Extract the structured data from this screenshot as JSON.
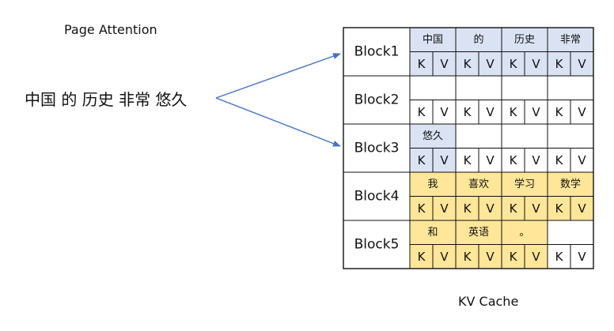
{
  "title": "Page Attention",
  "sentence": "中国 的 历史 非常 悠久",
  "cache_label": "KV Cache",
  "colors": {
    "blue_fill": "#dae3f3",
    "yellow_fill": "#ffe699",
    "white_fill": "#ffffff",
    "border": "#111111",
    "arrow": "#4472c4"
  },
  "blocks": [
    {
      "name": "Block1",
      "slots": [
        {
          "token": "中国",
          "filled": true,
          "fill": "blue"
        },
        {
          "token": "的",
          "filled": true,
          "fill": "blue"
        },
        {
          "token": "历史",
          "filled": true,
          "fill": "blue"
        },
        {
          "token": "非常",
          "filled": true,
          "fill": "blue"
        }
      ]
    },
    {
      "name": "Block2",
      "slots": [
        {
          "token": "",
          "filled": false,
          "fill": "white"
        },
        {
          "token": "",
          "filled": false,
          "fill": "white"
        },
        {
          "token": "",
          "filled": false,
          "fill": "white"
        },
        {
          "token": "",
          "filled": false,
          "fill": "white"
        }
      ]
    },
    {
      "name": "Block3",
      "slots": [
        {
          "token": "悠久",
          "filled": true,
          "fill": "blue"
        },
        {
          "token": "",
          "filled": false,
          "fill": "white"
        },
        {
          "token": "",
          "filled": false,
          "fill": "white"
        },
        {
          "token": "",
          "filled": false,
          "fill": "white"
        }
      ]
    },
    {
      "name": "Block4",
      "slots": [
        {
          "token": "我",
          "filled": true,
          "fill": "yellow"
        },
        {
          "token": "喜欢",
          "filled": true,
          "fill": "yellow"
        },
        {
          "token": "学习",
          "filled": true,
          "fill": "yellow"
        },
        {
          "token": "数学",
          "filled": true,
          "fill": "yellow"
        }
      ]
    },
    {
      "name": "Block5",
      "slots": [
        {
          "token": "和",
          "filled": true,
          "fill": "yellow"
        },
        {
          "token": "英语",
          "filled": true,
          "fill": "yellow"
        },
        {
          "token": "。",
          "filled": true,
          "fill": "yellow"
        },
        {
          "token": "",
          "filled": false,
          "fill": "white"
        }
      ]
    }
  ],
  "k_label": "K",
  "v_label": "V",
  "arrows_target_blocks": [
    "Block1",
    "Block3"
  ]
}
